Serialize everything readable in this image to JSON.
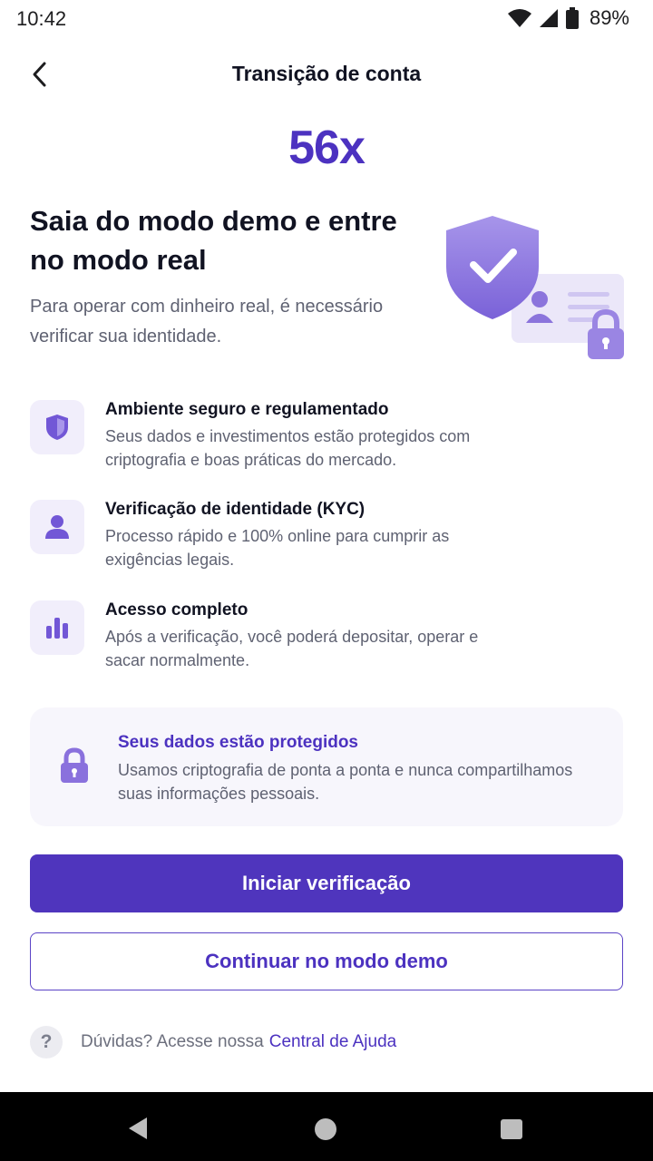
{
  "status_bar": {
    "time": "10:42",
    "battery": "89%"
  },
  "header": {
    "title": "Transição de conta",
    "back_icon": "chevron-left-icon"
  },
  "brand": {
    "logo_text": "56x",
    "color": "#4c32c0"
  },
  "hero": {
    "title": "Saia do modo demo e entre no modo real",
    "subtitle": "Para operar com dinheiro real, é necessário verificar sua identidade.",
    "illustration": "shield-id-card-lock-illustration"
  },
  "features": [
    {
      "icon": "shield-icon",
      "title": "Ambiente seguro e regulamentado",
      "description": "Seus dados e investimentos estão protegidos com criptografia e boas práticas do mercado."
    },
    {
      "icon": "user-icon",
      "title": "Verificação de identidade (KYC)",
      "description": "Processo rápido e 100% online para cumprir as exigências legais."
    },
    {
      "icon": "bar-chart-icon",
      "title": "Acesso completo",
      "description": "Após a verificação, você poderá depositar, operar e sacar normalmente."
    }
  ],
  "info_card": {
    "icon": "lock-icon",
    "title": "Seus dados estão protegidos",
    "description": "Usamos criptografia de ponta a ponta e nunca compartilhamos suas informações pessoais."
  },
  "actions": {
    "primary_label": "Iniciar verificação",
    "secondary_label": "Continuar no modo demo"
  },
  "help": {
    "icon": "question-icon",
    "text": "Dúvidas? Acesse nossa",
    "link_label": "Central de Ajuda"
  },
  "colors": {
    "accent": "#4f35bd",
    "accent_soft": "#f1eefb",
    "card_bg": "#f7f6fc"
  }
}
